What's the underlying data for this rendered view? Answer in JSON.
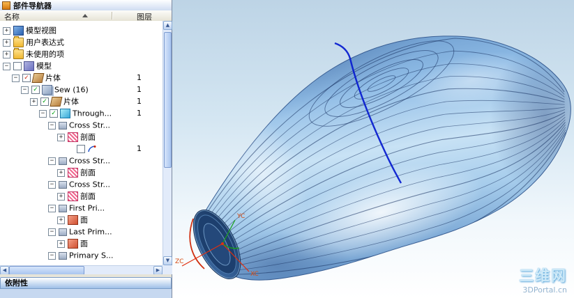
{
  "panel": {
    "title": "部件导航器",
    "columns": {
      "name": "名称",
      "layer": "图层"
    },
    "dependencies_bar": "依附性",
    "tree": [
      {
        "label": "模型视图",
        "depth": 0,
        "expander": "plus",
        "check": null,
        "icon": "model-views",
        "layer": ""
      },
      {
        "label": "用户表达式",
        "depth": 0,
        "expander": "plus",
        "check": null,
        "icon": "folder",
        "layer": ""
      },
      {
        "label": "未使用的项",
        "depth": 0,
        "expander": "plus",
        "check": null,
        "icon": "folder",
        "layer": ""
      },
      {
        "label": "模型",
        "depth": 0,
        "expander": "minus",
        "check": "empty",
        "icon": "model",
        "layer": ""
      },
      {
        "label": "片体",
        "depth": 1,
        "expander": "minus",
        "check": "red",
        "icon": "sheet",
        "layer": "1"
      },
      {
        "label": "Sew (16)",
        "depth": 2,
        "expander": "minus",
        "check": "green",
        "icon": "sew",
        "layer": "1"
      },
      {
        "label": "片体",
        "depth": 3,
        "expander": "plus",
        "check": "green",
        "icon": "sheet",
        "layer": "1"
      },
      {
        "label": "Through...",
        "depth": 4,
        "expander": "minus",
        "check": "green",
        "icon": "surface",
        "layer": "1"
      },
      {
        "label": "Cross Str...",
        "depth": 5,
        "expander": "minus",
        "check": null,
        "icon": "group",
        "layer": ""
      },
      {
        "label": "剖面",
        "depth": 6,
        "expander": "plus",
        "check": null,
        "icon": "section",
        "layer": ""
      },
      {
        "label": "",
        "depth": 7,
        "expander": null,
        "check": "empty",
        "icon": "curve",
        "layer": "1"
      },
      {
        "label": "Cross Str...",
        "depth": 5,
        "expander": "minus",
        "check": null,
        "icon": "group",
        "layer": ""
      },
      {
        "label": "剖面",
        "depth": 6,
        "expander": "plus",
        "check": null,
        "icon": "section",
        "layer": ""
      },
      {
        "label": "Cross Str...",
        "depth": 5,
        "expander": "minus",
        "check": null,
        "icon": "group",
        "layer": ""
      },
      {
        "label": "剖面",
        "depth": 6,
        "expander": "plus",
        "check": null,
        "icon": "section",
        "layer": ""
      },
      {
        "label": "First Pri...",
        "depth": 5,
        "expander": "minus",
        "check": null,
        "icon": "group",
        "layer": ""
      },
      {
        "label": "面",
        "depth": 6,
        "expander": "plus",
        "check": null,
        "icon": "face",
        "layer": ""
      },
      {
        "label": "Last Prim...",
        "depth": 5,
        "expander": "minus",
        "check": null,
        "icon": "group",
        "layer": ""
      },
      {
        "label": "面",
        "depth": 6,
        "expander": "plus",
        "check": null,
        "icon": "face",
        "layer": ""
      },
      {
        "label": "Primary S...",
        "depth": 5,
        "expander": "minus",
        "check": null,
        "icon": "group",
        "layer": ""
      }
    ]
  },
  "viewport": {
    "axes": {
      "x": "XC",
      "y": "YC",
      "z": "ZC"
    },
    "watermark": {
      "title": "三维网",
      "subtitle": "3DPortal.cn"
    }
  },
  "colors": {
    "model_blue": "#9cc6ea",
    "contour_line": "#16305e",
    "spline_blue": "#0a1fd0",
    "axis_red": "#e03010",
    "axis_green": "#18a018"
  }
}
